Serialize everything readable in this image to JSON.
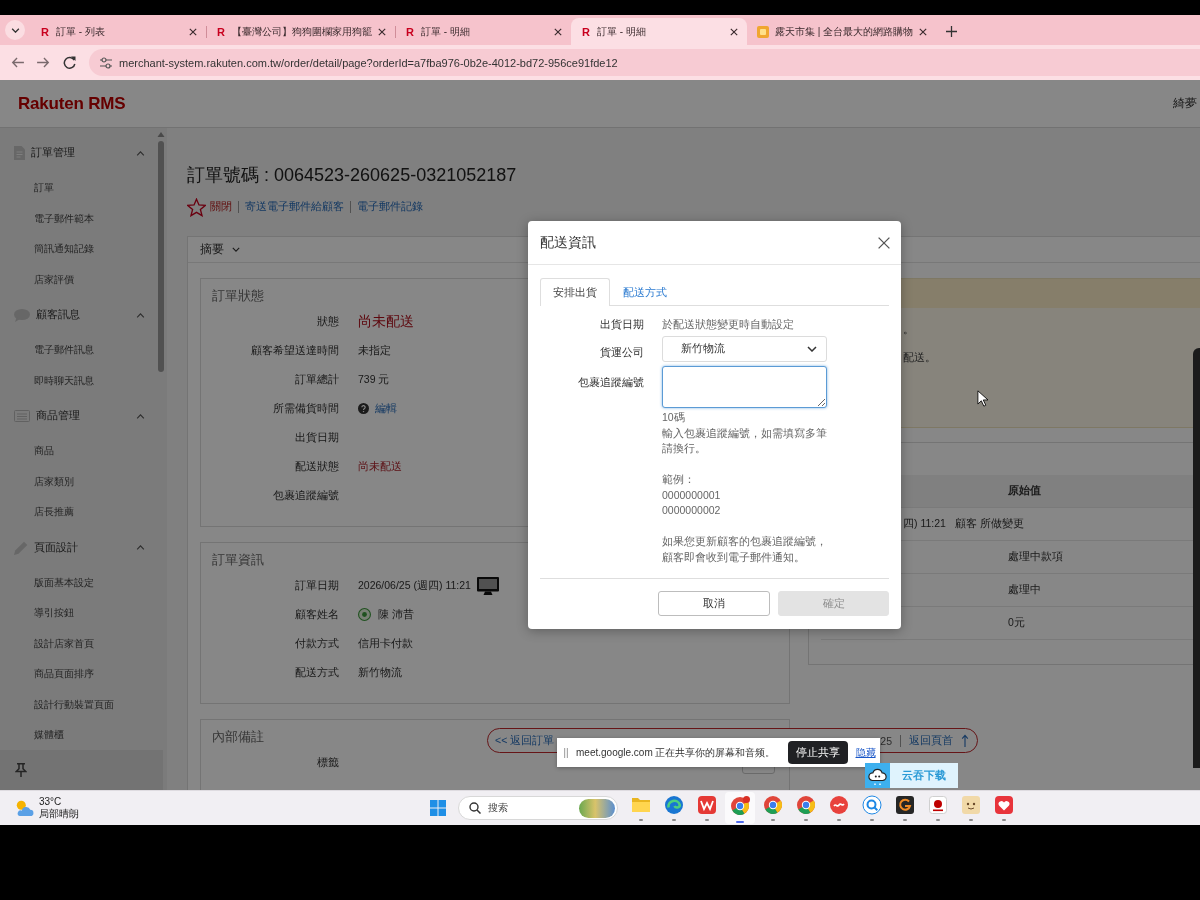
{
  "browser": {
    "tabs": [
      {
        "kind": "letter",
        "favicon": "R",
        "title": "訂單 - 列表",
        "selected": false
      },
      {
        "kind": "letter",
        "favicon": "R",
        "title": "【臺灣公司】狗狗圍欄家用狗籠",
        "selected": false
      },
      {
        "kind": "letter",
        "favicon": "R",
        "title": "訂單 - 明細",
        "selected": false
      },
      {
        "kind": "letter",
        "favicon": "R",
        "title": "訂單 - 明細",
        "selected": true
      },
      {
        "kind": "tile",
        "title": "露天市集 | 全台最大的網路購物",
        "selected": false
      }
    ],
    "url": "merchant-system.rakuten.com.tw/order/detail/page?orderId=a7fba976-0b2e-4012-bd72-956ce91fde12"
  },
  "header": {
    "logo": "Rakuten RMS",
    "user": "綺夢"
  },
  "sidebar": {
    "groups": [
      {
        "kind": "document",
        "label": "訂單管理",
        "expanded": true,
        "children": [
          {
            "label": "訂單"
          },
          {
            "label": "電子郵件範本"
          },
          {
            "label": "簡訊通知記錄"
          },
          {
            "label": "店家評價"
          }
        ]
      },
      {
        "kind": "chat",
        "label": "顧客訊息",
        "expanded": true,
        "children": [
          {
            "label": "電子郵件訊息"
          },
          {
            "label": "即時聊天訊息"
          }
        ]
      },
      {
        "kind": "list",
        "label": "商品管理",
        "expanded": true,
        "children": [
          {
            "label": "商品"
          },
          {
            "label": "店家類別"
          },
          {
            "label": "店長推薦"
          }
        ]
      },
      {
        "kind": "pencil",
        "label": "頁面設計",
        "expanded": true,
        "children": [
          {
            "label": "版面基本設定"
          },
          {
            "label": "導引按鈕"
          },
          {
            "label": "設計店家首頁"
          },
          {
            "label": "商品頁面排序"
          },
          {
            "label": "設計行動裝置頁面"
          },
          {
            "label": "媒體櫃"
          }
        ]
      }
    ]
  },
  "order": {
    "title": "訂單號碼 : 0064523-260625-0321052187",
    "starred": false,
    "actions": [
      {
        "kind": "danger",
        "label": "關閉"
      },
      {
        "kind": "link",
        "label": "寄送電子郵件給顧客"
      },
      {
        "kind": "link",
        "label": "電子郵件記錄"
      }
    ],
    "summary": "摘要",
    "cards": [
      {
        "title": "訂單狀態",
        "rows": [
          {
            "kind": "status",
            "label": "狀態",
            "value": "尚未配送"
          },
          {
            "kind": "text",
            "label": "顧客希望送達時間",
            "value": "未指定"
          },
          {
            "kind": "text",
            "label": "訂單總計",
            "value": "739 元"
          },
          {
            "kind": "help-link",
            "label": "所需備貨時間",
            "value": "編輯"
          },
          {
            "kind": "text",
            "label": "出貨日期"
          },
          {
            "kind": "alert",
            "label": "配送狀態",
            "value": "尚未配送"
          },
          {
            "kind": "text",
            "label": "包裹追蹤編號"
          }
        ]
      },
      {
        "title": "訂單資訊",
        "rows": [
          {
            "kind": "device",
            "label": "訂單日期",
            "value": "2026/06/25 (週四) 11:21"
          },
          {
            "kind": "member",
            "label": "顧客姓名",
            "value": "陳 沛昔"
          },
          {
            "kind": "text",
            "label": "付款方式",
            "value": "信用卡付款"
          },
          {
            "kind": "text",
            "label": "配送方式",
            "value": "新竹物流"
          }
        ]
      },
      {
        "title": "內部備註",
        "rows": [
          {
            "kind": "field",
            "label": "標籤"
          }
        ]
      }
    ],
    "notice": {
      "lines": [
        "。",
        "配送。"
      ]
    },
    "history": {
      "header": "原始值",
      "rows": [
        {
          "kind": "group",
          "cells": [
            "四) 11:21",
            "顧客 所做變更"
          ]
        },
        {
          "kind": "value",
          "value": "處理中款項"
        },
        {
          "kind": "value",
          "value": "處理中"
        },
        {
          "kind": "value",
          "value": "0元"
        }
      ]
    },
    "pagination": {
      "back": "<< 返回訂單",
      "count": "25",
      "top": "返回頁首"
    }
  },
  "dialog": {
    "title": "配送資訊",
    "tabs": [
      {
        "label": "安排出貨",
        "selected": true
      },
      {
        "label": "配送方式",
        "selected": false
      }
    ],
    "fields": [
      {
        "kind": "text",
        "label": "出貨日期",
        "value": "於配送狀態變更時自動設定"
      },
      {
        "kind": "select",
        "label": "貨運公司",
        "value": "新竹物流"
      },
      {
        "kind": "textarea",
        "label": "包裹追蹤編號",
        "focused": true,
        "help": {
          "length": "10碼",
          "instruction": "輸入包裹追蹤編號，如需填寫多筆請換行。",
          "example_label": "範例：",
          "examples": [
            "0000000001",
            "0000000002"
          ],
          "notice": "如果您更新顧客的包裹追蹤編號，顧客即會收到電子郵件通知。"
        }
      }
    ],
    "buttons": [
      {
        "kind": "secondary",
        "label": "取消",
        "disabled": false
      },
      {
        "kind": "primary",
        "label": "確定",
        "disabled": true
      }
    ]
  },
  "meet": {
    "message": "meet.google.com 正在共享你的屏幕和音频。",
    "stop": "停止共享",
    "hide": "隐藏"
  },
  "widget": {
    "label": "云吞下载"
  },
  "taskbar": {
    "weather": {
      "temp": "33°C",
      "condition": "局部晴朗"
    },
    "search": {
      "label": "搜索"
    },
    "apps": [
      {
        "kind": "folder",
        "active": false,
        "badge": false
      },
      {
        "kind": "swirl",
        "active": false,
        "badge": false
      },
      {
        "kind": "zigzag",
        "active": false,
        "badge": false
      },
      {
        "kind": "ring",
        "active": true,
        "badge": true
      },
      {
        "kind": "ring",
        "active": false,
        "badge": false
      },
      {
        "kind": "ring",
        "active": false,
        "badge": false
      },
      {
        "kind": "bubble",
        "active": false,
        "badge": false
      },
      {
        "kind": "lens",
        "active": false,
        "badge": false
      },
      {
        "kind": "arc",
        "active": false,
        "badge": false
      },
      {
        "kind": "dot",
        "active": false,
        "badge": false
      },
      {
        "kind": "smile",
        "active": false,
        "badge": false
      },
      {
        "kind": "heart",
        "active": false,
        "badge": false
      }
    ]
  }
}
